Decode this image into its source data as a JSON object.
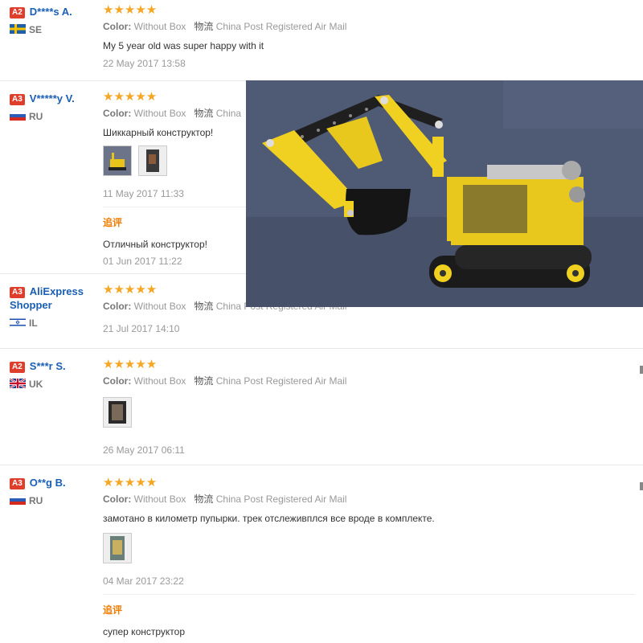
{
  "reviews": [
    {
      "level": "A2",
      "name": "D****s A.",
      "country": "SE",
      "stars": "★★★★★",
      "color_label": "Color:",
      "color_value": "Without Box",
      "shipping_label": "物流",
      "shipping_value": "China Post Registered Air Mail",
      "text": "My 5 year old was super happy with it",
      "time": "22 May 2017 13:58"
    },
    {
      "level": "A3",
      "name": "V*****y V.",
      "country": "RU",
      "stars": "★★★★★",
      "color_label": "Color:",
      "color_value": "Without Box",
      "shipping_label": "物流",
      "shipping_value": "China",
      "text": "Шиккарный конструктор!",
      "time": "11 May 2017 11:33",
      "followup": {
        "label": "追评",
        "text": "Отличный конструктор!",
        "time": "01 Jun 2017 11:22"
      }
    },
    {
      "level": "A3",
      "name": "AliExpress Shopper",
      "country": "IL",
      "stars": "★★★★★",
      "color_label": "Color:",
      "color_value": "Without Box",
      "shipping_label": "物流",
      "shipping_value": "China Post Registered Air Mail",
      "time": "21 Jul 2017 14:10"
    },
    {
      "level": "A2",
      "name": "S***r S.",
      "country": "UK",
      "stars": "★★★★★",
      "color_label": "Color:",
      "color_value": "Without Box",
      "shipping_label": "物流",
      "shipping_value": "China Post Registered Air Mail",
      "time": "26 May 2017 06:11"
    },
    {
      "level": "A3",
      "name": "O**g B.",
      "country": "RU",
      "stars": "★★★★★",
      "color_label": "Color:",
      "color_value": "Without Box",
      "shipping_label": "物流",
      "shipping_value": "China Post Registered Air Mail",
      "text": "замотано в километр пупырки. трек отслеживплся все вроде в комплекте.",
      "time": "04 Mar 2017 23:22",
      "followup": {
        "label": "追评",
        "text": "супер конструктор"
      }
    }
  ],
  "colors": {
    "accent_name": "#1a5fb4",
    "star": "#f5a623",
    "level_badge": "#e03e2d",
    "followup": "#f07c00"
  }
}
